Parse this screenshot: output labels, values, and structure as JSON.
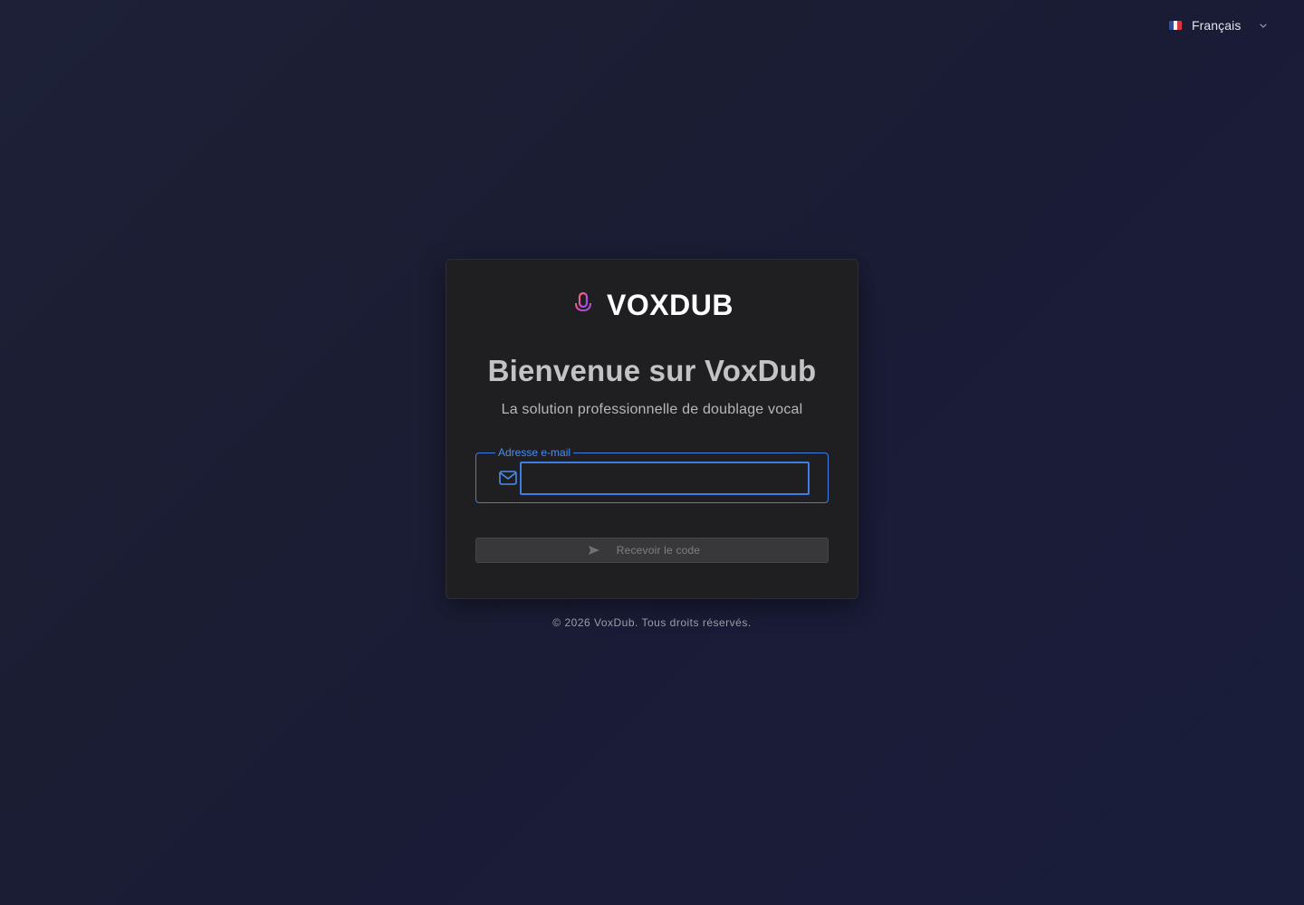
{
  "language_selector": {
    "label": "Français",
    "flag_icon": "france-flag-icon",
    "chevron_icon": "chevron-down-icon"
  },
  "brand": {
    "name": "VOXDUB",
    "icon": "microphone-icon",
    "icon_gradient": [
      "#ff5f6d",
      "#c94bd6",
      "#7b4fe0"
    ]
  },
  "login": {
    "title": "Bienvenue sur VoxDub",
    "subtitle": "La solution professionnelle de doublage vocal",
    "email_label": "Adresse e-mail",
    "email_value": "",
    "email_icon": "mail-icon",
    "submit_label": "Recevoir le code",
    "submit_icon": "send-icon",
    "submit_disabled": true
  },
  "colors": {
    "accent": "#3d7ee4",
    "card_background": "#1f1f21",
    "page_background": "#1b1d35"
  },
  "footer": {
    "copyright": "© 2026 VoxDub. Tous droits réservés."
  }
}
